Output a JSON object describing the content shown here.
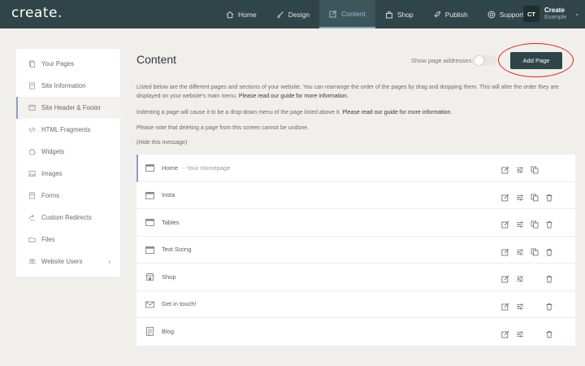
{
  "app": {
    "logo": "create.",
    "nav": [
      {
        "label": "Home",
        "icon": "home-icon"
      },
      {
        "label": "Design",
        "icon": "brush-icon"
      },
      {
        "label": "Content",
        "icon": "edit-icon",
        "active": true
      },
      {
        "label": "Shop",
        "icon": "bag-icon"
      },
      {
        "label": "Publish",
        "icon": "rocket-icon"
      },
      {
        "label": "Support",
        "icon": "lifebuoy-icon"
      }
    ],
    "user": {
      "initials": "CT",
      "name": "Create",
      "subtitle": "Example"
    }
  },
  "sidebar": {
    "items": [
      {
        "label": "Your Pages",
        "icon": "pages-icon"
      },
      {
        "label": "Site Information",
        "icon": "document-icon"
      },
      {
        "label": "Site Header & Footer",
        "icon": "layout-icon",
        "active": true
      },
      {
        "label": "HTML Fragments",
        "icon": "code-icon"
      },
      {
        "label": "Widgets",
        "icon": "puzzle-icon"
      },
      {
        "label": "Images",
        "icon": "image-icon"
      },
      {
        "label": "Forms",
        "icon": "form-icon"
      },
      {
        "label": "Custom Redirects",
        "icon": "redirect-icon"
      },
      {
        "label": "Files",
        "icon": "folder-icon"
      },
      {
        "label": "Website Users",
        "icon": "users-icon",
        "caret": "›"
      }
    ]
  },
  "main": {
    "title": "Content",
    "toggle_label": "Show page addresses:",
    "add_button": "Add Page",
    "info": {
      "p1_text": "Listed below are the different pages and sections of your website. You can rearrange the order of the pages by drag and dropping them. This will alter the order they are displayed on your website's main menu.",
      "p1_link": "Please read our guide for more information.",
      "p2_text": "Indenting a page will cause it to be a drop-down menu of the page listed above it.",
      "p2_link": "Please read our guide for more information.",
      "p3_text": "Please note that deleting a page from this screen cannot be undone.",
      "hide": "(Hide this message)"
    },
    "pages": [
      {
        "title": "Home",
        "subtitle": "- Your Homepage",
        "icon": "page-icon",
        "copy": true,
        "delete": false
      },
      {
        "title": "Insta",
        "subtitle": "",
        "icon": "page-icon",
        "copy": true,
        "delete": true
      },
      {
        "title": "Tables",
        "subtitle": "",
        "icon": "page-icon",
        "copy": true,
        "delete": true
      },
      {
        "title": "Text Sizing",
        "subtitle": "",
        "icon": "page-icon",
        "copy": true,
        "delete": true
      },
      {
        "title": "Shop",
        "subtitle": "",
        "icon": "shop-icon",
        "copy": false,
        "delete": true
      },
      {
        "title": "Get in touch!",
        "subtitle": "",
        "icon": "mail-icon",
        "copy": false,
        "delete": true
      },
      {
        "title": "Blog",
        "subtitle": "",
        "icon": "blog-icon",
        "copy": false,
        "delete": true
      }
    ]
  },
  "colors": {
    "topbar": "#2f4548",
    "accent": "#8d9bc7",
    "annotation": "#e0261e"
  }
}
